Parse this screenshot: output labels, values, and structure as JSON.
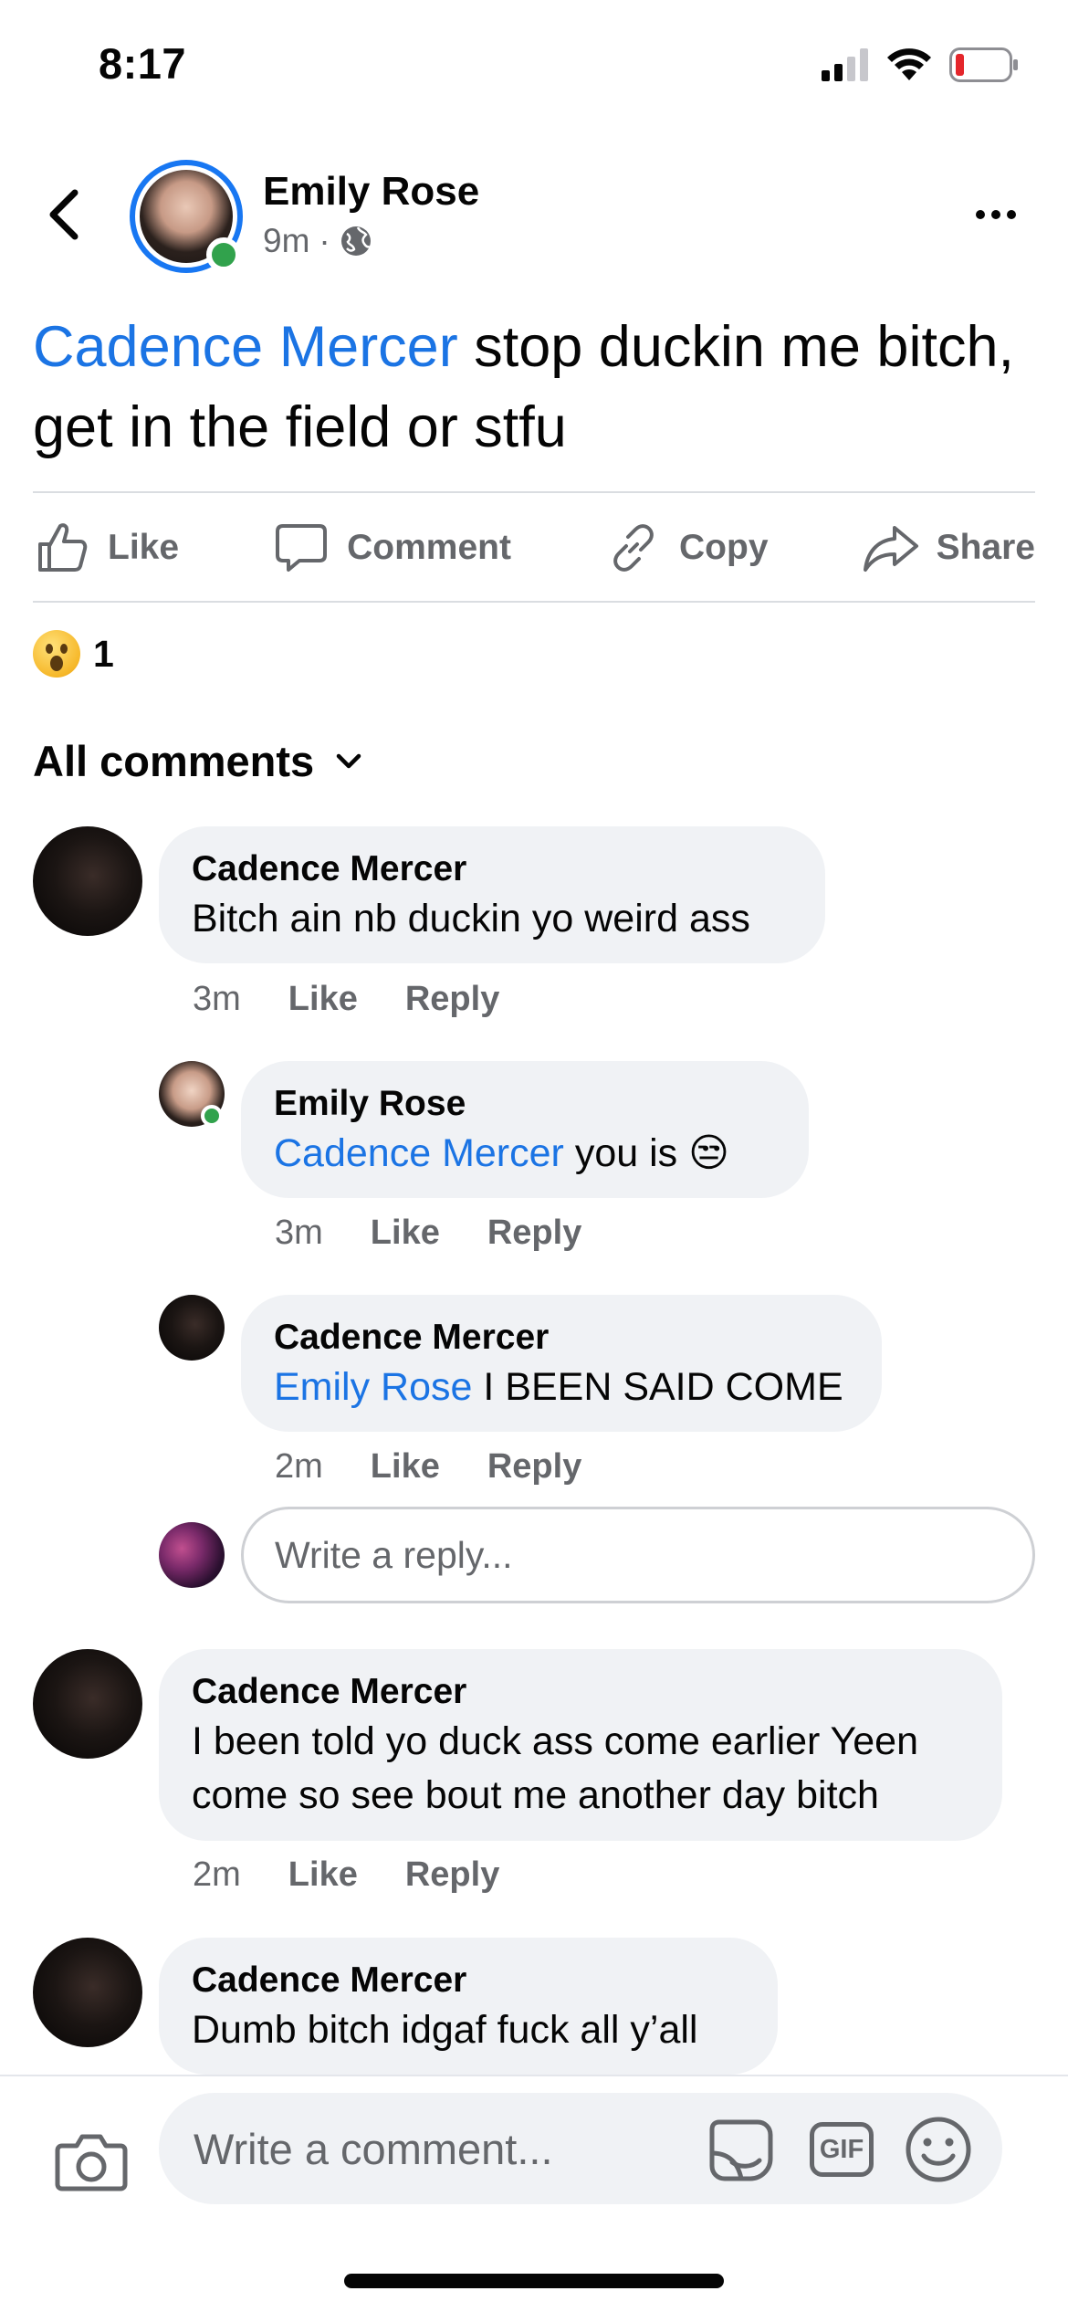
{
  "status_bar": {
    "time": "8:17",
    "battery_color": "#e4262b"
  },
  "post": {
    "author": "Emily Rose",
    "time": "9m",
    "separator": "·",
    "visibility_icon": "globe-icon",
    "text_mention": "Cadence Mercer",
    "text_body": " stop duckin me bitch, get in the field or stfu"
  },
  "actions": {
    "like": "Like",
    "comment": "Comment",
    "copy": "Copy",
    "share": "Share"
  },
  "reactions": {
    "emoji": "wow",
    "count": "1"
  },
  "comments_header": "All comments",
  "comments": [
    {
      "name": "Cadence Mercer",
      "text": "Bitch ain nb duckin yo weird ass",
      "time": "3m",
      "like": "Like",
      "reply": "Reply"
    },
    {
      "name": "Emily Rose",
      "mention": "Cadence Mercer",
      "text": " you is ",
      "emoji": "😒",
      "time": "3m",
      "like": "Like",
      "reply": "Reply"
    },
    {
      "name": "Cadence Mercer",
      "mention": "Emily Rose",
      "text": " I BEEN SAID COME",
      "time": "2m",
      "like": "Like",
      "reply": "Reply"
    },
    {
      "name": "Cadence Mercer",
      "text": "I been told yo duck ass come earlier Yeen come so see bout me another day bitch",
      "time": "2m",
      "like": "Like",
      "reply": "Reply"
    },
    {
      "name": "Cadence Mercer",
      "text": "Dumb bitch idgaf fuck all y’all"
    }
  ],
  "reply_input": {
    "placeholder": "Write a reply..."
  },
  "composer": {
    "placeholder": "Write a comment...",
    "gif_label": "GIF"
  },
  "colors": {
    "accent": "#1877f2",
    "mention": "#1b74e4",
    "online": "#31a24c",
    "bubble": "#f0f2f5",
    "secondary_text": "#65676b"
  }
}
